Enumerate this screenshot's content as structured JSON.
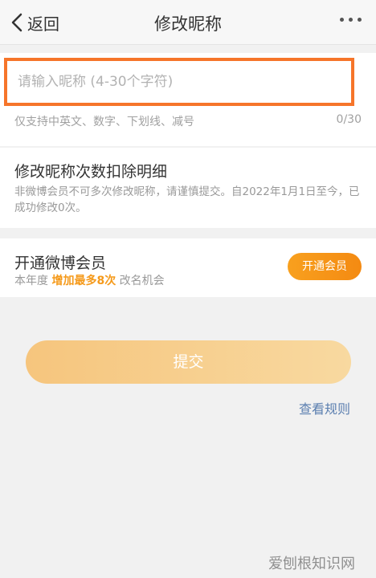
{
  "nav": {
    "back_label": "返回",
    "title": "修改昵称"
  },
  "input": {
    "placeholder": "请输入昵称 (4-30个字符)",
    "value": "",
    "hint": "仅支持中英文、数字、下划线、减号",
    "counter": "0/30"
  },
  "deduction": {
    "title": "修改昵称次数扣除明细",
    "desc": "非微博会员不可多次修改昵称，请谨慎提交。自2022年1月1日至今，已成功修改0次。"
  },
  "vip": {
    "title": "开通微博会员",
    "sub_prefix": "本年度 ",
    "sub_highlight": "增加最多8次",
    "sub_suffix": " 改名机会",
    "button": "开通会员"
  },
  "submit_label": "提交",
  "rules_link": "查看规则",
  "watermark": "爱刨根知识网"
}
